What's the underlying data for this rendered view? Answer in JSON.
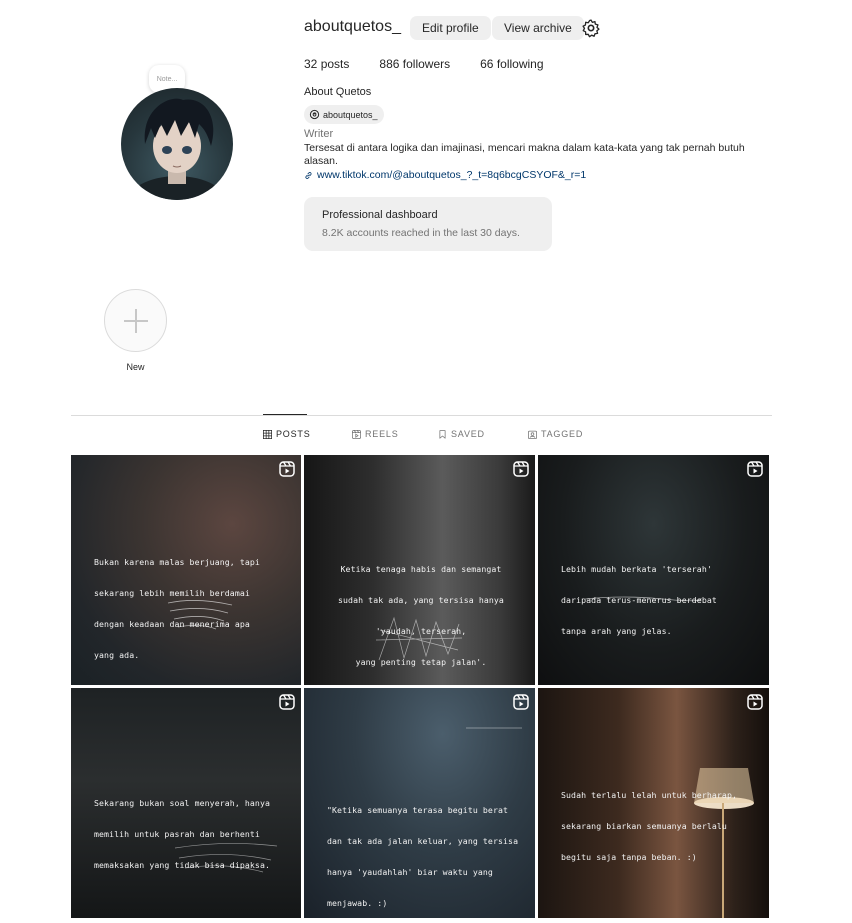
{
  "profile": {
    "username": "aboutquetos_",
    "note_placeholder": "Note...",
    "edit_profile_label": "Edit profile",
    "view_archive_label": "View archive",
    "posts_count": "32",
    "posts_label": "posts",
    "followers_count": "886",
    "followers_label": "followers",
    "following_count": "66",
    "following_label": "following",
    "full_name": "About Quetos",
    "threads_handle": "aboutquetos_",
    "category": "Writer",
    "bio": "Tersesat di antara logika dan imajinasi, mencari makna dalam kata-kata yang tak pernah butuh alasan.",
    "link": "www.tiktok.com/@aboutquetos_?_t=8q6bcgCSYOF&_r=1"
  },
  "dashboard": {
    "title": "Professional dashboard",
    "subtitle": "8.2K accounts reached in the last 30 days."
  },
  "highlights": {
    "new_label": "New"
  },
  "tabs": [
    {
      "label": "POSTS",
      "icon": "grid-icon",
      "active": true
    },
    {
      "label": "REELS",
      "icon": "reels-icon",
      "active": false
    },
    {
      "label": "SAVED",
      "icon": "bookmark-icon",
      "active": false
    },
    {
      "label": "TAGGED",
      "icon": "tag-icon",
      "active": false
    }
  ],
  "posts": [
    {
      "lines": [
        "Bukan karena malas berjuang, tapi",
        "sekarang lebih memilih berdamai",
        "dengan keadaan dan menerima apa",
        "yang ada."
      ]
    },
    {
      "lines": [
        "Ketika tenaga habis dan semangat",
        "sudah tak ada, yang tersisa hanya",
        "'yaudah, terserah,",
        "yang penting tetap jalan'."
      ]
    },
    {
      "lines": [
        "Lebih mudah berkata 'terserah'",
        "daripada terus-menerus berdebat",
        "tanpa arah yang jelas."
      ]
    },
    {
      "lines": [
        "Sekarang bukan soal menyerah, hanya",
        "memilih untuk pasrah dan berhenti",
        "memaksakan yang tidak bisa dipaksa."
      ]
    },
    {
      "lines": [
        "\"Ketika semuanya terasa begitu berat",
        "dan tak ada jalan keluar, yang tersisa",
        "hanya 'yaudahlah' biar waktu yang",
        "menjawab. :)"
      ]
    },
    {
      "lines": [
        "Sudah terlalu lelah untuk berharap,",
        "sekarang biarkan semuanya berlalu",
        "begitu saja tanpa beban. :)"
      ]
    }
  ]
}
